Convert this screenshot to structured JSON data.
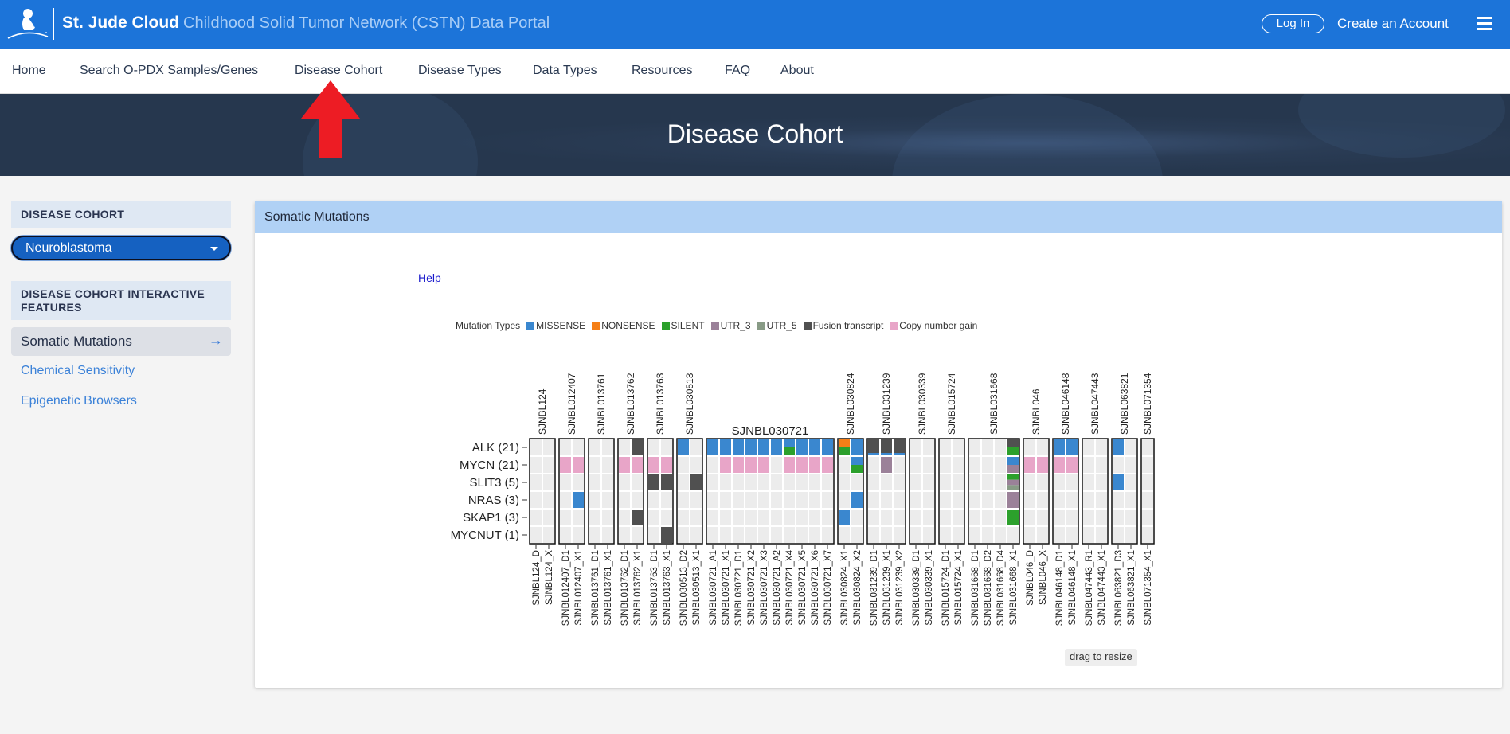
{
  "header": {
    "brand": "St. Jude Cloud",
    "subtitle": "Childhood Solid Tumor Network (CSTN) Data Portal",
    "login_label": "Log In",
    "create_account_label": "Create an Account",
    "logo_icon": "st-jude-child-logo-icon",
    "menu_icon": "hamburger-menu-icon"
  },
  "nav": {
    "items": [
      {
        "label": "Home"
      },
      {
        "label": "Search O-PDX Samples/Genes"
      },
      {
        "label": "Disease Cohort"
      },
      {
        "label": "Disease Types"
      },
      {
        "label": "Data Types"
      },
      {
        "label": "Resources"
      },
      {
        "label": "FAQ"
      },
      {
        "label": "About"
      }
    ]
  },
  "hero": {
    "title": "Disease Cohort"
  },
  "annotation": {
    "arrow_color": "#ed1c24",
    "points_to": "Disease Cohort"
  },
  "sidebar": {
    "cohort_heading": "DISEASE COHORT",
    "cohort_selected": "Neuroblastoma",
    "features_heading": "DISEASE COHORT INTERACTIVE FEATURES",
    "items": [
      {
        "label": "Somatic Mutations",
        "active": true
      },
      {
        "label": "Chemical Sensitivity",
        "active": false
      },
      {
        "label": "Epigenetic Browsers",
        "active": false
      }
    ]
  },
  "panel": {
    "title": "Somatic Mutations",
    "help_label": "Help",
    "resize_label": "drag to resize"
  },
  "legend": {
    "title": "Mutation Types",
    "types": [
      {
        "key": "missense",
        "label": "MISSENSE",
        "color": "#3a87cf"
      },
      {
        "key": "nonsense",
        "label": "NONSENSE",
        "color": "#f57f17"
      },
      {
        "key": "silent",
        "label": "SILENT",
        "color": "#2ca02c"
      },
      {
        "key": "utr3",
        "label": "UTR_3",
        "color": "#9b8199"
      },
      {
        "key": "utr5",
        "label": "UTR_5",
        "color": "#889b86"
      },
      {
        "key": "fusion",
        "label": "Fusion transcript",
        "color": "#505050"
      },
      {
        "key": "cnv",
        "label": "Copy number gain",
        "color": "#e8a5c8"
      }
    ]
  },
  "chart_data": {
    "type": "heatmap",
    "title": "Somatic Mutations",
    "genes": [
      "ALK (21)",
      "MYCN (21)",
      "SLIT3 (5)",
      "NRAS (3)",
      "SKAP1 (3)",
      "MYCNUT (1)"
    ],
    "empty_color": "#ececec",
    "groups": [
      {
        "name": "SJNBL124",
        "samples": [
          {
            "id": "SJNBL124_D",
            "cells": {}
          },
          {
            "id": "SJNBL124_X",
            "cells": {}
          }
        ]
      },
      {
        "name": "SJNBL012407",
        "samples": [
          {
            "id": "SJNBL012407_D1",
            "cells": {
              "1": [
                "cnv"
              ]
            }
          },
          {
            "id": "SJNBL012407_X1",
            "cells": {
              "1": [
                "cnv"
              ],
              "3": [
                "missense"
              ]
            }
          }
        ]
      },
      {
        "name": "SJNBL013761",
        "samples": [
          {
            "id": "SJNBL013761_D1",
            "cells": {}
          },
          {
            "id": "SJNBL013761_X1",
            "cells": {}
          }
        ]
      },
      {
        "name": "SJNBL013762",
        "samples": [
          {
            "id": "SJNBL013762_D1",
            "cells": {
              "1": [
                "cnv"
              ]
            }
          },
          {
            "id": "SJNBL013762_X1",
            "cells": {
              "0": [
                "fusion"
              ],
              "1": [
                "cnv"
              ],
              "4": [
                "fusion"
              ]
            }
          }
        ]
      },
      {
        "name": "SJNBL013763",
        "samples": [
          {
            "id": "SJNBL013763_D1",
            "cells": {
              "1": [
                "cnv"
              ],
              "2": [
                "fusion"
              ]
            }
          },
          {
            "id": "SJNBL013763_X1",
            "cells": {
              "1": [
                "cnv"
              ],
              "2": [
                "fusion"
              ],
              "5": [
                "fusion"
              ]
            }
          }
        ]
      },
      {
        "name": "SJNBL030513",
        "samples": [
          {
            "id": "SJNBL030513_D2",
            "cells": {
              "0": [
                "missense"
              ]
            }
          },
          {
            "id": "SJNBL030513_X1",
            "cells": {
              "2": [
                "fusion"
              ]
            }
          }
        ]
      },
      {
        "name": "SJNBL030721",
        "horizontal_label": true,
        "samples": [
          {
            "id": "SJNBL030721_A1",
            "cells": {
              "0": [
                "missense"
              ]
            }
          },
          {
            "id": "SJNBL030721_X1",
            "cells": {
              "0": [
                "missense"
              ],
              "1": [
                "cnv"
              ]
            }
          },
          {
            "id": "SJNBL030721_D1",
            "cells": {
              "0": [
                "missense"
              ],
              "1": [
                "cnv"
              ]
            }
          },
          {
            "id": "SJNBL030721_X2",
            "cells": {
              "0": [
                "missense"
              ],
              "1": [
                "cnv"
              ]
            }
          },
          {
            "id": "SJNBL030721_X3",
            "cells": {
              "0": [
                "missense"
              ],
              "1": [
                "cnv"
              ]
            }
          },
          {
            "id": "SJNBL030721_A2",
            "cells": {
              "0": [
                "missense"
              ]
            }
          },
          {
            "id": "SJNBL030721_X4",
            "cells": {
              "0": [
                "missense",
                "silent"
              ],
              "1": [
                "cnv"
              ]
            }
          },
          {
            "id": "SJNBL030721_X5",
            "cells": {
              "0": [
                "missense"
              ],
              "1": [
                "cnv"
              ]
            }
          },
          {
            "id": "SJNBL030721_X6",
            "cells": {
              "0": [
                "missense"
              ],
              "1": [
                "cnv"
              ]
            }
          },
          {
            "id": "SJNBL030721_X7",
            "cells": {
              "0": [
                "missense"
              ],
              "1": [
                "cnv"
              ]
            }
          }
        ]
      },
      {
        "name": "SJNBL030824",
        "samples": [
          {
            "id": "SJNBL030824_X1",
            "cells": {
              "0": [
                "nonsense",
                "silent"
              ],
              "4": [
                "missense"
              ]
            }
          },
          {
            "id": "SJNBL030824_X2",
            "cells": {
              "0": [
                "missense"
              ],
              "1": [
                "missense",
                "silent"
              ],
              "3": [
                "missense"
              ]
            }
          }
        ]
      },
      {
        "name": "SJNBL031239",
        "samples": [
          {
            "id": "SJNBL031239_D1",
            "cells": {
              "0": [
                "fusion",
                "missense-thin"
              ]
            }
          },
          {
            "id": "SJNBL031239_X1",
            "cells": {
              "0": [
                "fusion",
                "missense-thin"
              ],
              "1": [
                "utr3"
              ]
            }
          },
          {
            "id": "SJNBL031239_X2",
            "cells": {
              "0": [
                "fusion",
                "missense-thin"
              ]
            }
          }
        ]
      },
      {
        "name": "SJNBL030339",
        "samples": [
          {
            "id": "SJNBL030339_D1",
            "cells": {}
          },
          {
            "id": "SJNBL030339_X1",
            "cells": {}
          }
        ]
      },
      {
        "name": "SJNBL015724",
        "samples": [
          {
            "id": "SJNBL015724_D1",
            "cells": {}
          },
          {
            "id": "SJNBL015724_X1",
            "cells": {}
          }
        ]
      },
      {
        "name": "SJNBL031668",
        "samples": [
          {
            "id": "SJNBL031668_D1",
            "cells": {}
          },
          {
            "id": "SJNBL031668_D2",
            "cells": {}
          },
          {
            "id": "SJNBL031668_D4",
            "cells": {}
          },
          {
            "id": "SJNBL031668_X1",
            "cells": {
              "0": [
                "fusion",
                "silent"
              ],
              "1": [
                "missense",
                "utr3"
              ],
              "2": [
                "silent",
                "utr3",
                "utr5"
              ],
              "3": [
                "utr3"
              ],
              "4": [
                "silent"
              ]
            }
          }
        ]
      },
      {
        "name": "SJNBL046",
        "samples": [
          {
            "id": "SJNBL046_D",
            "cells": {
              "1": [
                "cnv"
              ]
            }
          },
          {
            "id": "SJNBL046_X",
            "cells": {
              "1": [
                "cnv"
              ]
            }
          }
        ]
      },
      {
        "name": "SJNBL046148",
        "samples": [
          {
            "id": "SJNBL046148_D1",
            "cells": {
              "0": [
                "missense"
              ],
              "1": [
                "cnv"
              ]
            }
          },
          {
            "id": "SJNBL046148_X1",
            "cells": {
              "0": [
                "missense"
              ],
              "1": [
                "cnv"
              ]
            }
          }
        ]
      },
      {
        "name": "SJNBL047443",
        "samples": [
          {
            "id": "SJNBL047443_R1",
            "cells": {}
          },
          {
            "id": "SJNBL047443_X1",
            "cells": {}
          }
        ]
      },
      {
        "name": "SJNBL063821",
        "samples": [
          {
            "id": "SJNBL063821_D3",
            "cells": {
              "0": [
                "missense"
              ],
              "2": [
                "missense"
              ]
            }
          },
          {
            "id": "SJNBL063821_X1",
            "cells": {}
          }
        ]
      },
      {
        "name": "SJNBL071354",
        "samples": [
          {
            "id": "SJNBL071354_X1",
            "cells": {}
          }
        ]
      }
    ]
  }
}
